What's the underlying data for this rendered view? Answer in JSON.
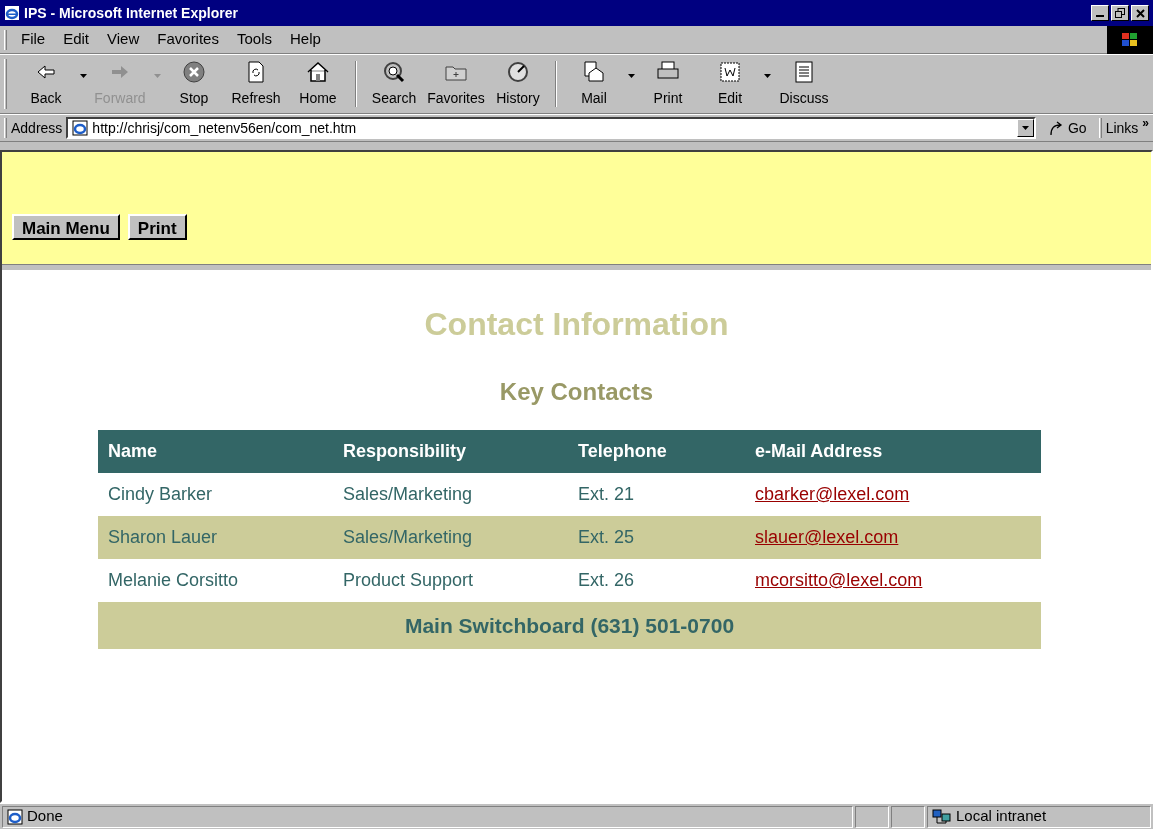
{
  "window": {
    "title": "IPS - Microsoft Internet Explorer"
  },
  "menu": [
    "File",
    "Edit",
    "View",
    "Favorites",
    "Tools",
    "Help"
  ],
  "toolbar": [
    {
      "label": "Back",
      "kind": "back",
      "dropdown": true,
      "disabled": false
    },
    {
      "label": "Forward",
      "kind": "forward",
      "dropdown": true,
      "disabled": true
    },
    {
      "label": "Stop",
      "kind": "stop",
      "dropdown": false,
      "disabled": false
    },
    {
      "label": "Refresh",
      "kind": "refresh",
      "dropdown": false,
      "disabled": false
    },
    {
      "label": "Home",
      "kind": "home",
      "dropdown": false,
      "disabled": false
    },
    {
      "label": "Search",
      "kind": "search",
      "dropdown": false,
      "disabled": false
    },
    {
      "label": "Favorites",
      "kind": "favorites",
      "dropdown": false,
      "disabled": false
    },
    {
      "label": "History",
      "kind": "history",
      "dropdown": false,
      "disabled": false
    },
    {
      "label": "Mail",
      "kind": "mail",
      "dropdown": true,
      "disabled": false
    },
    {
      "label": "Print",
      "kind": "print",
      "dropdown": false,
      "disabled": false
    },
    {
      "label": "Edit",
      "kind": "edit",
      "dropdown": true,
      "disabled": false
    },
    {
      "label": "Discuss",
      "kind": "discuss",
      "dropdown": false,
      "disabled": false
    }
  ],
  "address_bar": {
    "label": "Address",
    "value": "http://chrisj/com_netenv56en/com_net.htm",
    "go": "Go",
    "links": "Links",
    "more": "»"
  },
  "page": {
    "buttons": [
      "Main Menu",
      "Print"
    ],
    "title": "Contact Information",
    "subtitle": "Key Contacts",
    "table": {
      "columns": [
        "Name",
        "Responsibility",
        "Telephone",
        "e-Mail Address"
      ],
      "rows": [
        [
          "Cindy Barker",
          "Sales/Marketing",
          "Ext. 21",
          "cbarker@lexel.com"
        ],
        [
          "Sharon Lauer",
          "Sales/Marketing",
          "Ext. 25",
          "slauer@lexel.com"
        ],
        [
          "Melanie Corsitto",
          "Product Support",
          "Ext. 26",
          "mcorsitto@lexel.com"
        ]
      ],
      "footer": "Main Switchboard (631) 501-0700"
    }
  },
  "status_bar": {
    "text": "Done",
    "zone": "Local intranet"
  }
}
